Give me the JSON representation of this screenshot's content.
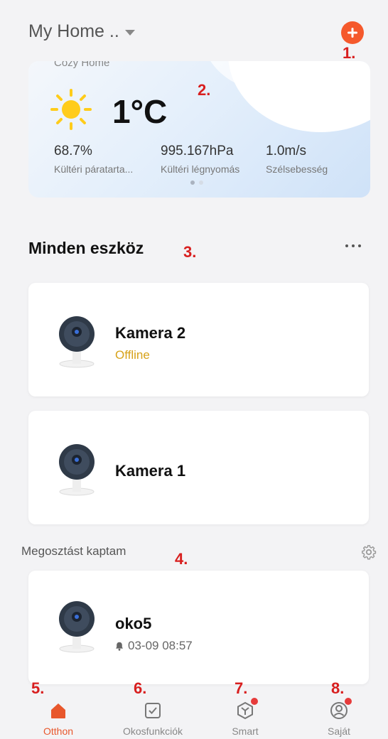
{
  "header": {
    "title": "My Home ..",
    "add_label": "+"
  },
  "markers": [
    "1.",
    "2.",
    "3.",
    "4.",
    "5.",
    "6.",
    "7.",
    "8."
  ],
  "weather": {
    "home_name": "Cozy Home",
    "temperature": "1°C",
    "stats": [
      {
        "value": "68.7%",
        "label": "Kültéri páratarta..."
      },
      {
        "value": "995.167hPa",
        "label": "Kültéri légnyomás"
      },
      {
        "value": "1.0m/s",
        "label": "Szélsebesség"
      }
    ],
    "page_index": 0,
    "page_count": 2
  },
  "devices": {
    "title": "Minden eszköz",
    "items": [
      {
        "name": "Kamera 2",
        "status": "Offline",
        "status_color": "#d7a21a"
      },
      {
        "name": "Kamera 1"
      }
    ]
  },
  "shared": {
    "title": "Megosztást kaptam",
    "items": [
      {
        "name": "oko5",
        "last_event": "03-09 08:57"
      }
    ]
  },
  "tabs": [
    {
      "label": "Otthon",
      "icon": "home-icon",
      "active": true,
      "badge": false
    },
    {
      "label": "Okosfunkciók",
      "icon": "checkbox-icon",
      "active": false,
      "badge": false
    },
    {
      "label": "Smart",
      "icon": "smart-hex-icon",
      "active": false,
      "badge": true
    },
    {
      "label": "Saját",
      "icon": "profile-icon",
      "active": false,
      "badge": true
    }
  ],
  "colors": {
    "accent": "#e8572c",
    "add_button": "#f5592c",
    "marker": "#d81f1f",
    "badge": "#e63b3b"
  }
}
